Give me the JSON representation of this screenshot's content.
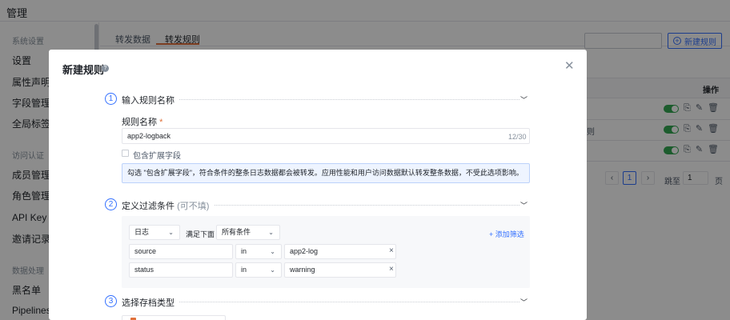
{
  "app": {
    "title": "管理",
    "sidebar": {
      "sections": [
        {
          "title": "系统设置",
          "items": [
            "设置",
            "属性声明",
            "字段管理",
            "全局标签"
          ]
        },
        {
          "title": "访问认证",
          "items": [
            "成员管理",
            "角色管理",
            "API Key 管",
            "邀请记录"
          ]
        },
        {
          "title": "数据处理",
          "items": [
            "黑名单",
            "Pipelines"
          ]
        }
      ]
    },
    "tabs": [
      "转发数据",
      "转发规则"
    ],
    "active_tab": "转发规则",
    "new_rule_button": "新建规则",
    "table": {
      "ops_header": "操作",
      "row_fragment": "则"
    },
    "pagination": {
      "current_page": "1",
      "jump_label": "跳至",
      "jump_value": "1",
      "page_suffix": "页"
    }
  },
  "modal": {
    "title": "新建规则",
    "steps": [
      {
        "num": "1",
        "title": "输入规则名称",
        "sub": ""
      },
      {
        "num": "2",
        "title": "定义过滤条件",
        "sub": "(可不填)"
      },
      {
        "num": "3",
        "title": "选择存档类型",
        "sub": ""
      }
    ],
    "rule_name_label": "规则名称",
    "required_mark": "*",
    "rule_name_value": "app2-logback",
    "char_count": "12/30",
    "checkbox_label": "包含扩展字段",
    "checked": false,
    "info_text": "勾选 \"包含扩展字段\"，符合条件的整条日志数据都会被转发。应用性能和用户访问数据默认转发整条数据，不受此选项影响。",
    "filter": {
      "type_select": "日志",
      "meet_label": "满足下面",
      "condition_select": "所有条件",
      "add_filter": "+ 添加筛选",
      "rows": [
        {
          "field": "source",
          "op": "in",
          "value": "app2-log"
        },
        {
          "field": "status",
          "op": "in",
          "value": "warning"
        }
      ]
    }
  },
  "colors": {
    "accent": "#3370ff",
    "brand_orange": "#e0703b",
    "toggle_on": "#34a853"
  }
}
